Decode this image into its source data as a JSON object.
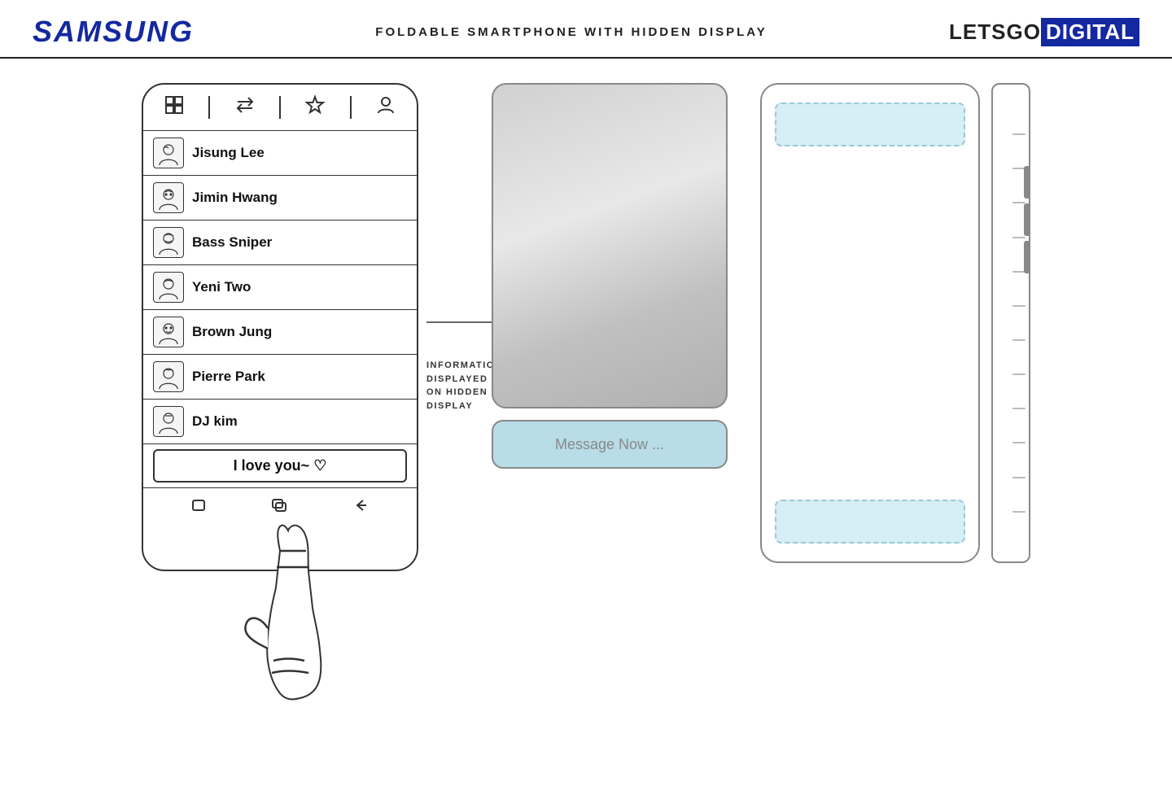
{
  "header": {
    "samsung_logo": "SAMSUNG",
    "page_title": "FOLDABLE SMARTPHONE WITH HIDDEN DISPLAY",
    "letsgo": "LETSGO",
    "digital": "DIGITAL"
  },
  "phone": {
    "topbar_icons": [
      "grid",
      "arrows",
      "star",
      "person"
    ],
    "contacts": [
      {
        "name": "Jisung Lee",
        "bold": true
      },
      {
        "name": "Jimin Hwang",
        "bold": true
      },
      {
        "name": "Bass Sniper",
        "bold": true
      },
      {
        "name": "Yeni Two",
        "bold": false
      },
      {
        "name": "Brown Jung",
        "bold": false
      },
      {
        "name": "Pierre Park",
        "bold": false
      },
      {
        "name": "DJ kim",
        "bold": false
      }
    ],
    "message": "I love you~ ♡",
    "bottom_icons": [
      "square",
      "circle-square",
      "back-arrow"
    ]
  },
  "hidden_display": {
    "message_placeholder": "Message Now ..."
  },
  "annotation": {
    "line1": "INFORMATION DISPLAYED",
    "line2": "ON HIDDEN DISPLAY"
  }
}
